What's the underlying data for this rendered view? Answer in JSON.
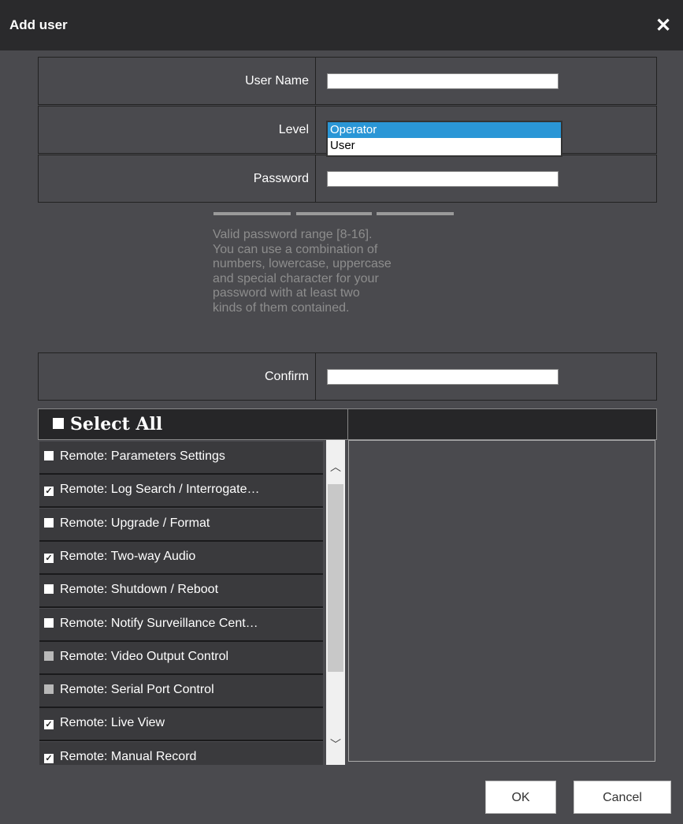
{
  "dialog": {
    "title": "Add user",
    "close_icon": "close-icon"
  },
  "form": {
    "user_name_label": "User Name",
    "user_name_value": "",
    "level_label": "Level",
    "level_options": [
      "Operator",
      "User"
    ],
    "level_selected": "Operator",
    "password_label": "Password",
    "password_value": "",
    "password_hint": "Valid password range [8-16].\nYou can use a combination of\nnumbers, lowercase, uppercase\nand special character for your\npassword with at least two\nkinds of them contained.",
    "confirm_label": "Confirm",
    "confirm_value": ""
  },
  "permissions": {
    "select_all_label": "Select All",
    "items": [
      {
        "label": "Remote: Parameters Settings",
        "state": "unchecked"
      },
      {
        "label": "Remote: Log Search / Interrogate…",
        "state": "checked"
      },
      {
        "label": "Remote: Upgrade / Format",
        "state": "unchecked"
      },
      {
        "label": "Remote: Two-way Audio",
        "state": "checked"
      },
      {
        "label": "Remote: Shutdown / Reboot",
        "state": "unchecked"
      },
      {
        "label": "Remote: Notify Surveillance Cent…",
        "state": "unchecked"
      },
      {
        "label": "Remote: Video Output Control",
        "state": "disabled"
      },
      {
        "label": "Remote: Serial Port Control",
        "state": "disabled"
      },
      {
        "label": "Remote: Live View",
        "state": "checked"
      },
      {
        "label": "Remote: Manual Record",
        "state": "checked"
      }
    ]
  },
  "buttons": {
    "ok_label": "OK",
    "cancel_label": "Cancel"
  },
  "colors": {
    "background": "#4a4a4e",
    "titlebar": "#2a2a2c",
    "selection": "#2a96d6"
  }
}
